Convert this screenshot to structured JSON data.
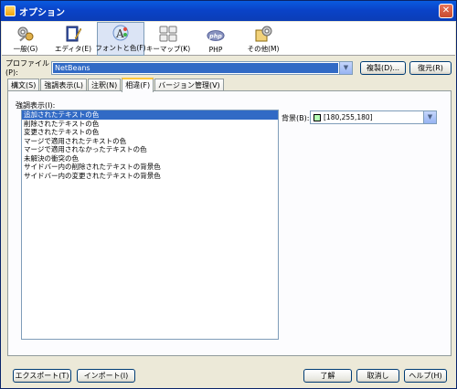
{
  "window": {
    "title": "オプション",
    "close_glyph": "✕"
  },
  "categories": [
    {
      "label": "一般(G)",
      "icon": "wrench-gears-icon"
    },
    {
      "label": "エディタ(E)",
      "icon": "editor-icon"
    },
    {
      "label": "フォントと色(F)",
      "icon": "font-color-icon"
    },
    {
      "label": "キーマップ(K)",
      "icon": "keymap-icon"
    },
    {
      "label": "PHP",
      "icon": "php-icon",
      "icon_text": "php"
    },
    {
      "label": "その他(M)",
      "icon": "misc-icon"
    }
  ],
  "profile": {
    "label": "プロファイル(P):",
    "value": "NetBeans",
    "duplicate_button": "複製(D)...",
    "restore_button": "復元(R)"
  },
  "tabs": [
    {
      "label": "構文(S)"
    },
    {
      "label": "強調表示(L)"
    },
    {
      "label": "注釈(N)"
    },
    {
      "label": "相違(F)",
      "selected": true
    },
    {
      "label": "バージョン管理(V)"
    }
  ],
  "highlight": {
    "label": "強調表示(I):",
    "items": [
      "追加されたテキストの色",
      "削除されたテキストの色",
      "変更されたテキストの色",
      "マージで適用されたテキストの色",
      "マージで適用されなかったテキストの色",
      "未解決の衝突の色",
      "サイドバー内の削除されたテキストの背景色",
      "サイドバー内の変更されたテキストの背景色"
    ],
    "selected_index": 0
  },
  "background": {
    "label": "背景(B):",
    "value": "[180,255,180]",
    "swatch_color": "#b4ffb4"
  },
  "buttons": {
    "export": "エクスポート(T)",
    "import": "インポート(I)",
    "ok": "了解",
    "cancel": "取消し",
    "help": "ヘルプ(H)"
  }
}
